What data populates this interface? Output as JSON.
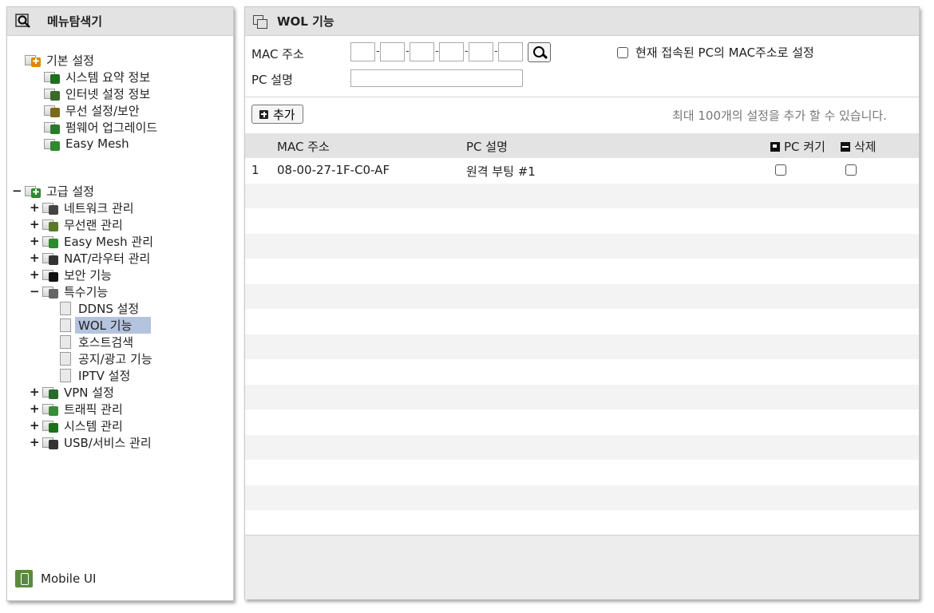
{
  "left_panel": {
    "title": "메뉴탐색기",
    "basic_group": {
      "label": "기본 설정",
      "items": [
        {
          "label": "시스템 요약 정보",
          "icon": "bar-chart-icon",
          "color": "#1d6e1d"
        },
        {
          "label": "인터넷 설정 정보",
          "icon": "monitor-icon",
          "color": "#3a6a2a"
        },
        {
          "label": "무선 설정/보안",
          "icon": "wifi-icon",
          "color": "#7a6a1a"
        },
        {
          "label": "펌웨어 업그레이드",
          "icon": "upgrade-icon",
          "color": "#2a7a2a"
        },
        {
          "label": "Easy Mesh",
          "icon": "mesh-icon",
          "color": "#2d8a2d"
        }
      ]
    },
    "advanced_group": {
      "toggle": "−",
      "label": "고급 설정",
      "items": [
        {
          "toggle": "+",
          "label": "네트워크 관리",
          "icon": "network-icon",
          "color": "#444444"
        },
        {
          "toggle": "+",
          "label": "무선랜 관리",
          "icon": "wifi-icon",
          "color": "#5a7a2a"
        },
        {
          "toggle": "+",
          "label": "Easy Mesh 관리",
          "icon": "mesh-icon",
          "color": "#2d8a2d"
        },
        {
          "toggle": "+",
          "label": "NAT/라우터 관리",
          "icon": "router-icon",
          "color": "#333333"
        },
        {
          "toggle": "+",
          "label": "보안 기능",
          "icon": "lock-icon",
          "color": "#111111"
        },
        {
          "toggle": "−",
          "label": "특수기능",
          "icon": "grid-icon",
          "color": "#666666"
        }
      ],
      "special_items": [
        {
          "label": "DDNS 설정"
        },
        {
          "label": "WOL 기능",
          "selected": true
        },
        {
          "label": "호스트검색"
        },
        {
          "label": "공지/광고 기능"
        },
        {
          "label": "IPTV 설정"
        }
      ],
      "more_items": [
        {
          "toggle": "+",
          "label": "VPN 설정",
          "icon": "vpn-icon",
          "color": "#2a6a2a"
        },
        {
          "toggle": "+",
          "label": "트래픽 관리",
          "icon": "traffic-icon",
          "color": "#3a8a3a"
        },
        {
          "toggle": "+",
          "label": "시스템 관리",
          "icon": "bar-chart-icon",
          "color": "#1d6e1d"
        },
        {
          "toggle": "+",
          "label": "USB/서비스 관리",
          "icon": "usb-icon",
          "color": "#333333"
        }
      ]
    },
    "mobile_ui": "Mobile UI"
  },
  "right_panel": {
    "title": "WOL 기능",
    "mac_label": "MAC 주소",
    "pc_desc_label": "PC 설명",
    "current_pc_label": "현재 접속된 PC의 MAC주소로 설정",
    "add_button": "추가",
    "max_note": "최대 100개의 설정을 추가 할 수 있습니다.",
    "table": {
      "headers": {
        "mac": "MAC 주소",
        "desc": "PC 설명",
        "power_on": "PC 켜기",
        "delete": "삭제"
      },
      "rows": [
        {
          "index": "1",
          "mac": "08-00-27-1F-C0-AF",
          "desc": "원격 부팅 #1"
        }
      ]
    }
  }
}
